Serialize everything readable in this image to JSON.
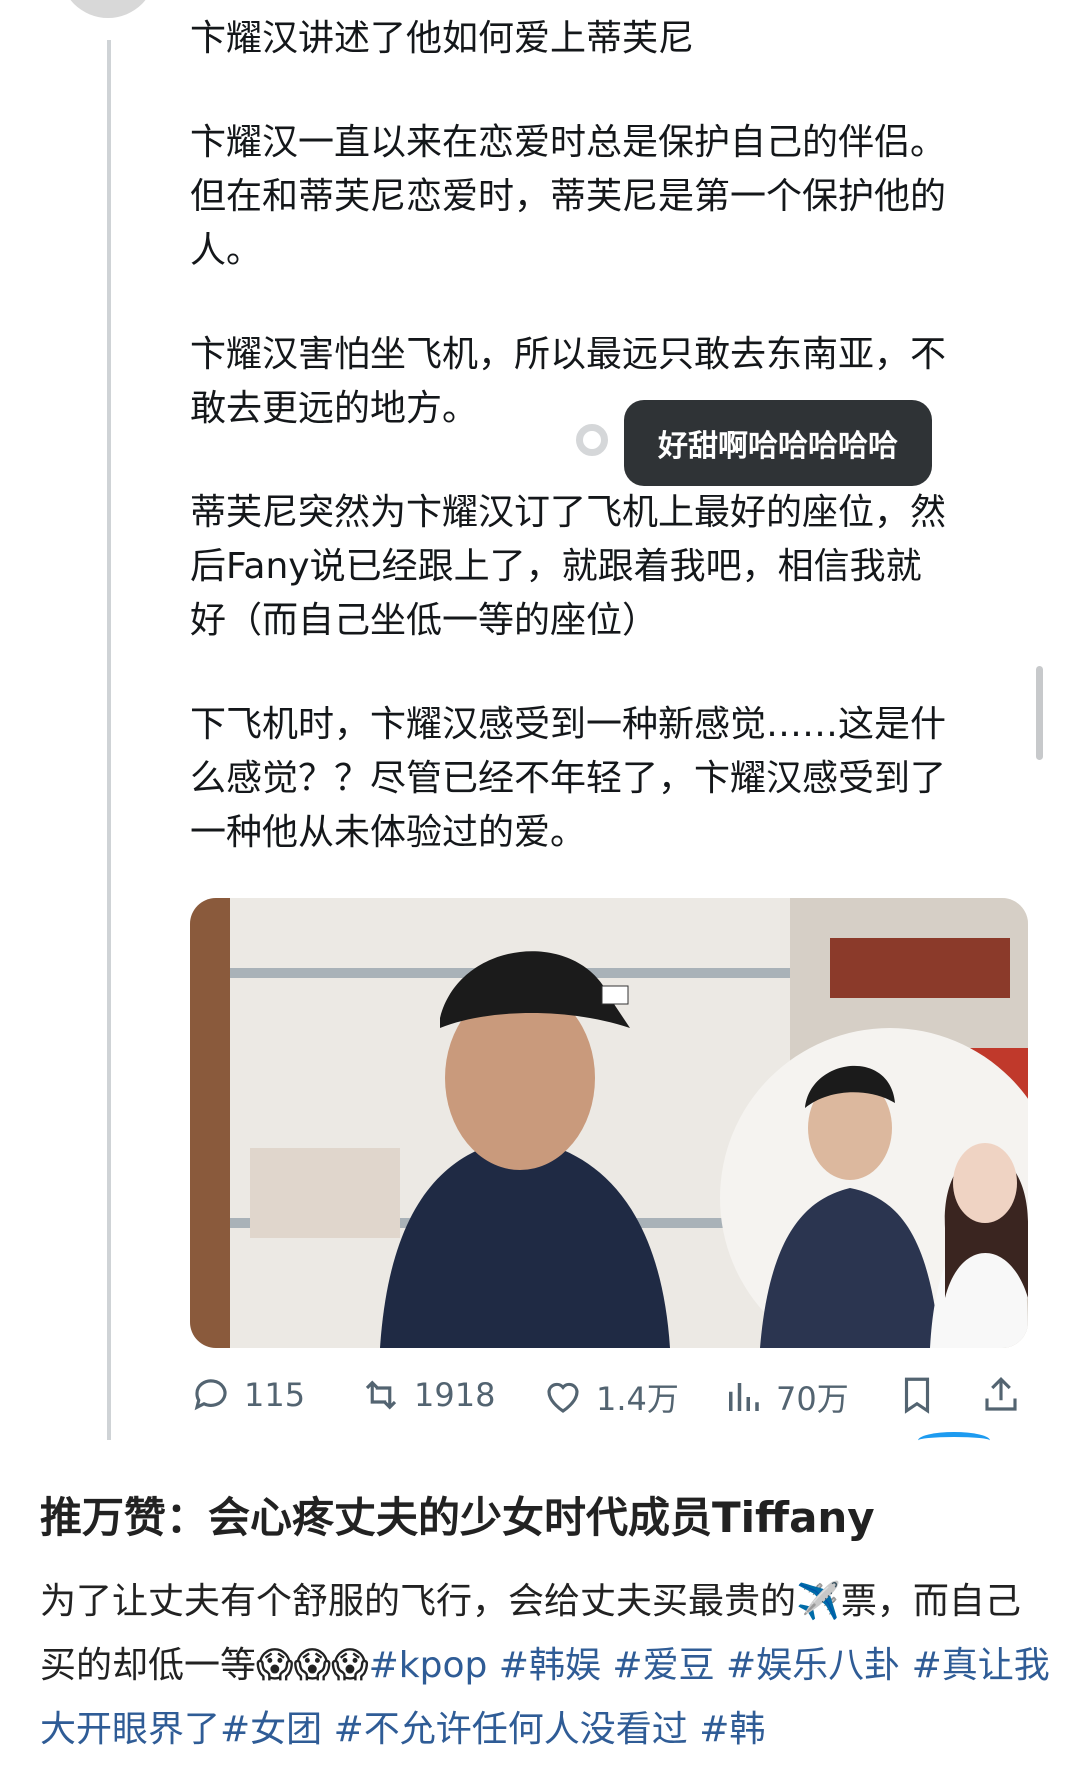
{
  "tweet": {
    "paragraphs": [
      "卞耀汉讲述了他如何爱上蒂芙尼",
      "卞耀汉一直以来在恋爱时总是保护自己的伴侣。\n但在和蒂芙尼恋爱时，蒂芙尼是第一个保护他的\n人。",
      "卞耀汉害怕坐飞机，所以最远只敢去东南亚，不\n敢去更远的地方。",
      "蒂芙尼突然为卞耀汉订了飞机上最好的座位，然\n后Fany说已经跟上了，就跟着我吧，相信我就\n好（而自己坐低一等的座位）",
      "下飞机时，卞耀汉感受到一种新感觉……这是什\n么感觉？？尽管已经不年轻了，卞耀汉感受到了\n一种他从未体验过的爱。"
    ],
    "bubble_text": "好甜啊哈哈哈哈哈",
    "actions": {
      "replies": "115",
      "retweets": "1918",
      "likes": "1.4万",
      "views": "70万"
    }
  },
  "post": {
    "title": "推万赞：会心疼丈夫的少女时代成员Tiffany",
    "body_part1": "为了让丈夫有个舒服的飞行，会给丈夫买最贵的",
    "body_part2": "票，而自己买的却低一等",
    "tags_line": "#kpop #韩娱 #爱豆 #娱乐八卦 #真让我大开眼界了#女团 #不允许任何人没看过 #韩"
  },
  "colors": {
    "icon_gray": "#536471",
    "accent_blue": "#1d9bf0",
    "tag_blue": "#2f5c96"
  }
}
